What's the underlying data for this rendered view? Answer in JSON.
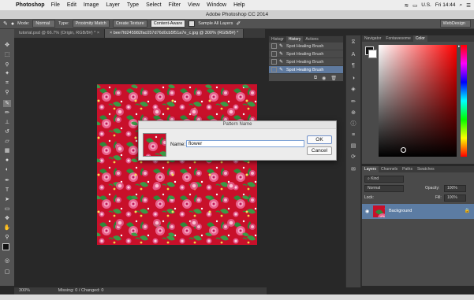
{
  "menubar": {
    "app_name": "Photoshop",
    "items": [
      "File",
      "Edit",
      "Image",
      "Layer",
      "Type",
      "Select",
      "Filter",
      "View",
      "Window",
      "Help"
    ],
    "status_text": "U.S.",
    "clock": "Fri 14:44"
  },
  "window_title": "Adobe Photoshop CC 2014",
  "options": {
    "mode_label": "Mode:",
    "mode_value": "Normal",
    "type_label": "Type:",
    "type_buttons": [
      "Proximity Match",
      "Create Texture",
      "Content-Aware"
    ],
    "sample_label": "Sample All Layers",
    "workspace": "WebDesign"
  },
  "doc_tabs": [
    {
      "label": "tutorial.psd @ 66.7% (Origin, RGB/8#) *"
    },
    {
      "label": "bee7fd245982fac057d76d0cb5f51a7e_c.jpg @ 300% (RGB/8#) *"
    }
  ],
  "dialog": {
    "title": "Pattern Name",
    "name_label": "Name:",
    "name_value": "flower",
    "ok": "OK",
    "cancel": "Cancel"
  },
  "status": {
    "zoom": "300%",
    "info": "Missing: 0 / Changed: 0"
  },
  "history_panel": {
    "tabs": [
      "Histogr",
      "History",
      "Actions"
    ],
    "items": [
      "Spot Healing Brush",
      "Spot Healing Brush",
      "Spot Healing Brush",
      "Spot Healing Brush"
    ]
  },
  "color_panel": {
    "tabs": [
      "Navigator",
      "Fontawesome",
      "Color"
    ]
  },
  "layers_panel": {
    "tabs": [
      "Layers",
      "Channels",
      "Paths",
      "Swatches"
    ],
    "kind": "Kind",
    "blend": "Normal",
    "opacity_label": "Opacity:",
    "opacity": "100%",
    "lock_label": "Lock:",
    "fill_label": "Fill:",
    "fill": "100%",
    "layer_name": "Background"
  },
  "colors": {
    "fabric_red": "#c8102a",
    "selection_blue": "#5c7ca3"
  }
}
